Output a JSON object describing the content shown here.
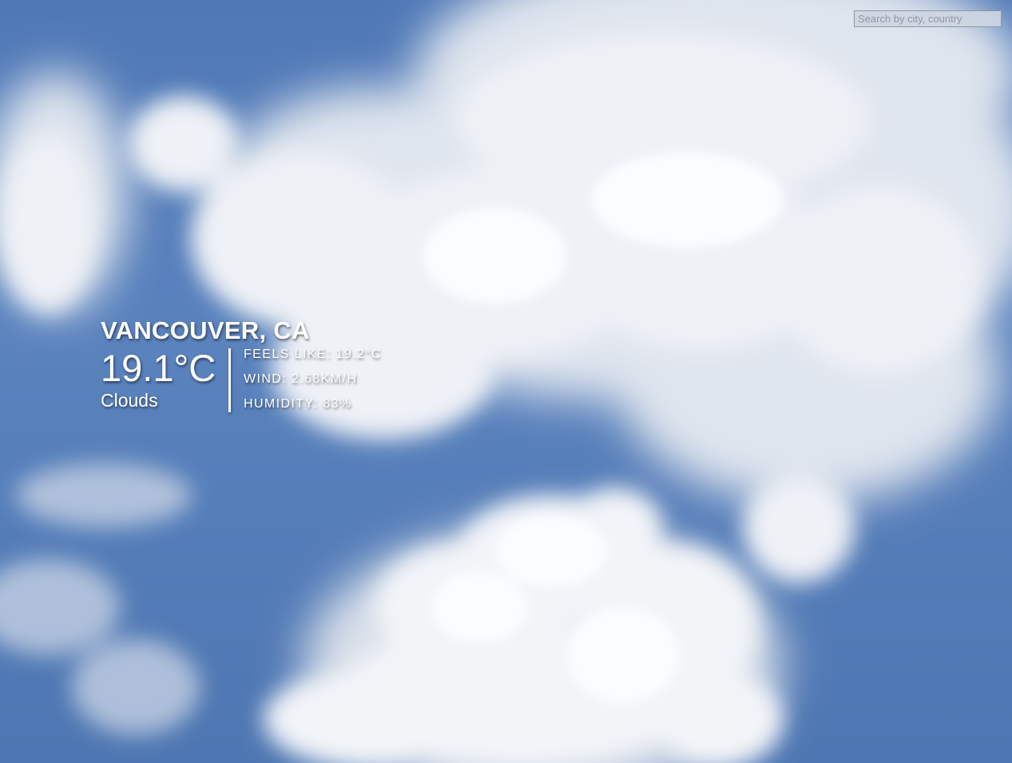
{
  "search": {
    "placeholder": "Search by city, country"
  },
  "weather": {
    "location": "VANCOUVER, CA",
    "temperature": "19.1°C",
    "condition": "Clouds",
    "feels_like": "FEELS LIKE: 19.2°C",
    "wind": "WIND: 2.68KM/H",
    "humidity": "HUMIDITY: 83%"
  },
  "colors": {
    "sky": "#4f78b6",
    "cloud": "#e6ebf2",
    "text": "#ffffff"
  }
}
